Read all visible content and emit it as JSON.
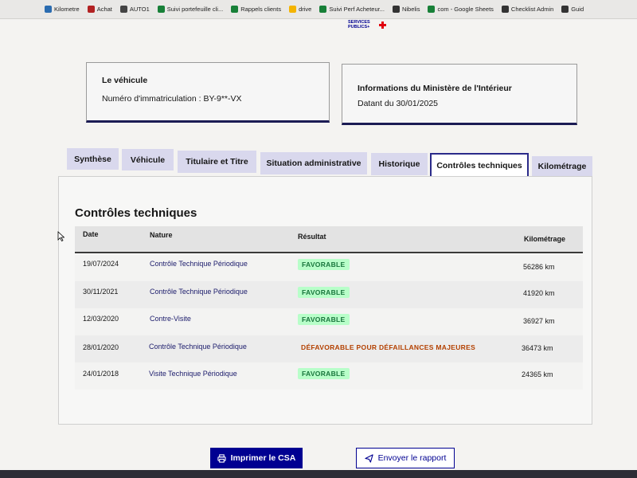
{
  "browser": {
    "bookmarks": [
      {
        "label": "Kilometre",
        "icon": "bookmark-icon",
        "color": "#2b6cb0"
      },
      {
        "label": "Achat",
        "icon": "bookmark-icon",
        "color": "#b22222"
      },
      {
        "label": "AUTO1",
        "icon": "bookmark-icon",
        "color": "#444444"
      },
      {
        "label": "Suivi portefeuille cli...",
        "icon": "sheets-icon",
        "color": "#188038"
      },
      {
        "label": "Rappels clients",
        "icon": "sheets-icon",
        "color": "#188038"
      },
      {
        "label": "drive",
        "icon": "drive-icon",
        "color": "#f4b400"
      },
      {
        "label": "Suivi Perf Acheteur...",
        "icon": "sheets-icon",
        "color": "#188038"
      },
      {
        "label": "Nibelis",
        "icon": "nibelis-icon",
        "color": "#333333"
      },
      {
        "label": "com - Google Sheets",
        "icon": "sheets-icon",
        "color": "#188038"
      },
      {
        "label": "Checklist Admin",
        "icon": "bookmark-icon",
        "color": "#333333"
      },
      {
        "label": "Guid",
        "icon": "bookmark-icon",
        "color": "#333333"
      }
    ]
  },
  "header": {
    "logo_line1": "SERVICES",
    "logo_line2": "PUBLICS+"
  },
  "vehicle_card": {
    "title": "Le véhicule",
    "registration_label": "Numéro d'immatriculation : BY-9**-VX"
  },
  "ministry_card": {
    "title": "Informations du Ministère de l'Intérieur",
    "date_label": "Datant du 30/01/2025"
  },
  "tabs": [
    {
      "label": "Synthèse",
      "active": false
    },
    {
      "label": "Véhicule",
      "active": false
    },
    {
      "label": "Titulaire et Titre",
      "active": false
    },
    {
      "label": "Situation administrative",
      "active": false
    },
    {
      "label": "Historique",
      "active": false
    },
    {
      "label": "Contrôles techniques",
      "active": true
    },
    {
      "label": "Kilométrage",
      "active": false
    }
  ],
  "section": {
    "title": "Contrôles techniques",
    "columns": {
      "date": "Date",
      "nature": "Nature",
      "result": "Résultat",
      "mileage": "Kilométrage"
    },
    "rows": [
      {
        "date": "19/07/2024",
        "nature": "Contrôle Technique Périodique",
        "result": "FAVORABLE",
        "status": "ok",
        "mileage": "56286 km"
      },
      {
        "date": "30/11/2021",
        "nature": "Contrôle Technique Périodique",
        "result": "FAVORABLE",
        "status": "ok",
        "mileage": "41920 km"
      },
      {
        "date": "12/03/2020",
        "nature": "Contre-Visite",
        "result": "FAVORABLE",
        "status": "ok",
        "mileage": "36927 km"
      },
      {
        "date": "28/01/2020",
        "nature": "Contrôle Technique Périodique",
        "result": "DÉFAVORABLE POUR DÉFAILLANCES MAJEURES",
        "status": "ko",
        "mileage": "36473 km"
      },
      {
        "date": "24/01/2018",
        "nature": "Visite Technique Périodique",
        "result": "FAVORABLE",
        "status": "ok",
        "mileage": "24365 km"
      }
    ]
  },
  "actions": {
    "print_label": "Imprimer le CSA",
    "print_icon": "printer-icon",
    "report_label": "Envoyer le rapport",
    "report_icon": "send-icon"
  },
  "colors": {
    "primary": "#000091",
    "favorable_bg": "#b8fec9",
    "favorable_text": "#18753c",
    "defavorable_text": "#b34000",
    "tab_bg": "#d9d8ed"
  }
}
